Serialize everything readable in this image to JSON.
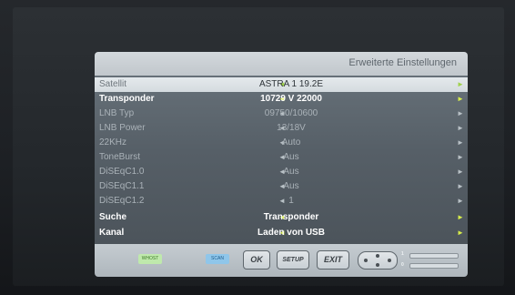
{
  "dialog": {
    "title": "Erweiterte Einstellungen",
    "rows": [
      {
        "label": "Satellit",
        "value": "ASTRA 1 19.2E"
      },
      {
        "label": "Transponder",
        "value": "10729 V 22000"
      },
      {
        "label": "LNB Typ",
        "value": "09750/10600"
      },
      {
        "label": "LNB Power",
        "value": "13/18V"
      },
      {
        "label": "22KHz",
        "value": "Auto"
      },
      {
        "label": "ToneBurst",
        "value": "Aus"
      },
      {
        "label": "DiSEqC1.0",
        "value": "Aus"
      },
      {
        "label": "DiSEqC1.1",
        "value": "Aus"
      },
      {
        "label": "DiSEqC1.2",
        "value": "1"
      },
      {
        "label": "Suche",
        "value": "Transponder"
      },
      {
        "label": "Kanal",
        "value": "Laden von USB"
      }
    ],
    "arrow_left": "◄",
    "arrow_right": "►"
  },
  "footer": {
    "green_button": "WHOST",
    "blue_button": "SCAN",
    "ok_key": "OK",
    "setup_key": "SETUP",
    "exit_key": "EXIT",
    "indicator_1": "1",
    "indicator_2": "0"
  },
  "colors": {
    "selected_row": "#dde3e7",
    "active_arrow": "#d8ee4a",
    "panel_body": "#5a636b",
    "header_bar": "#cfd5da"
  }
}
